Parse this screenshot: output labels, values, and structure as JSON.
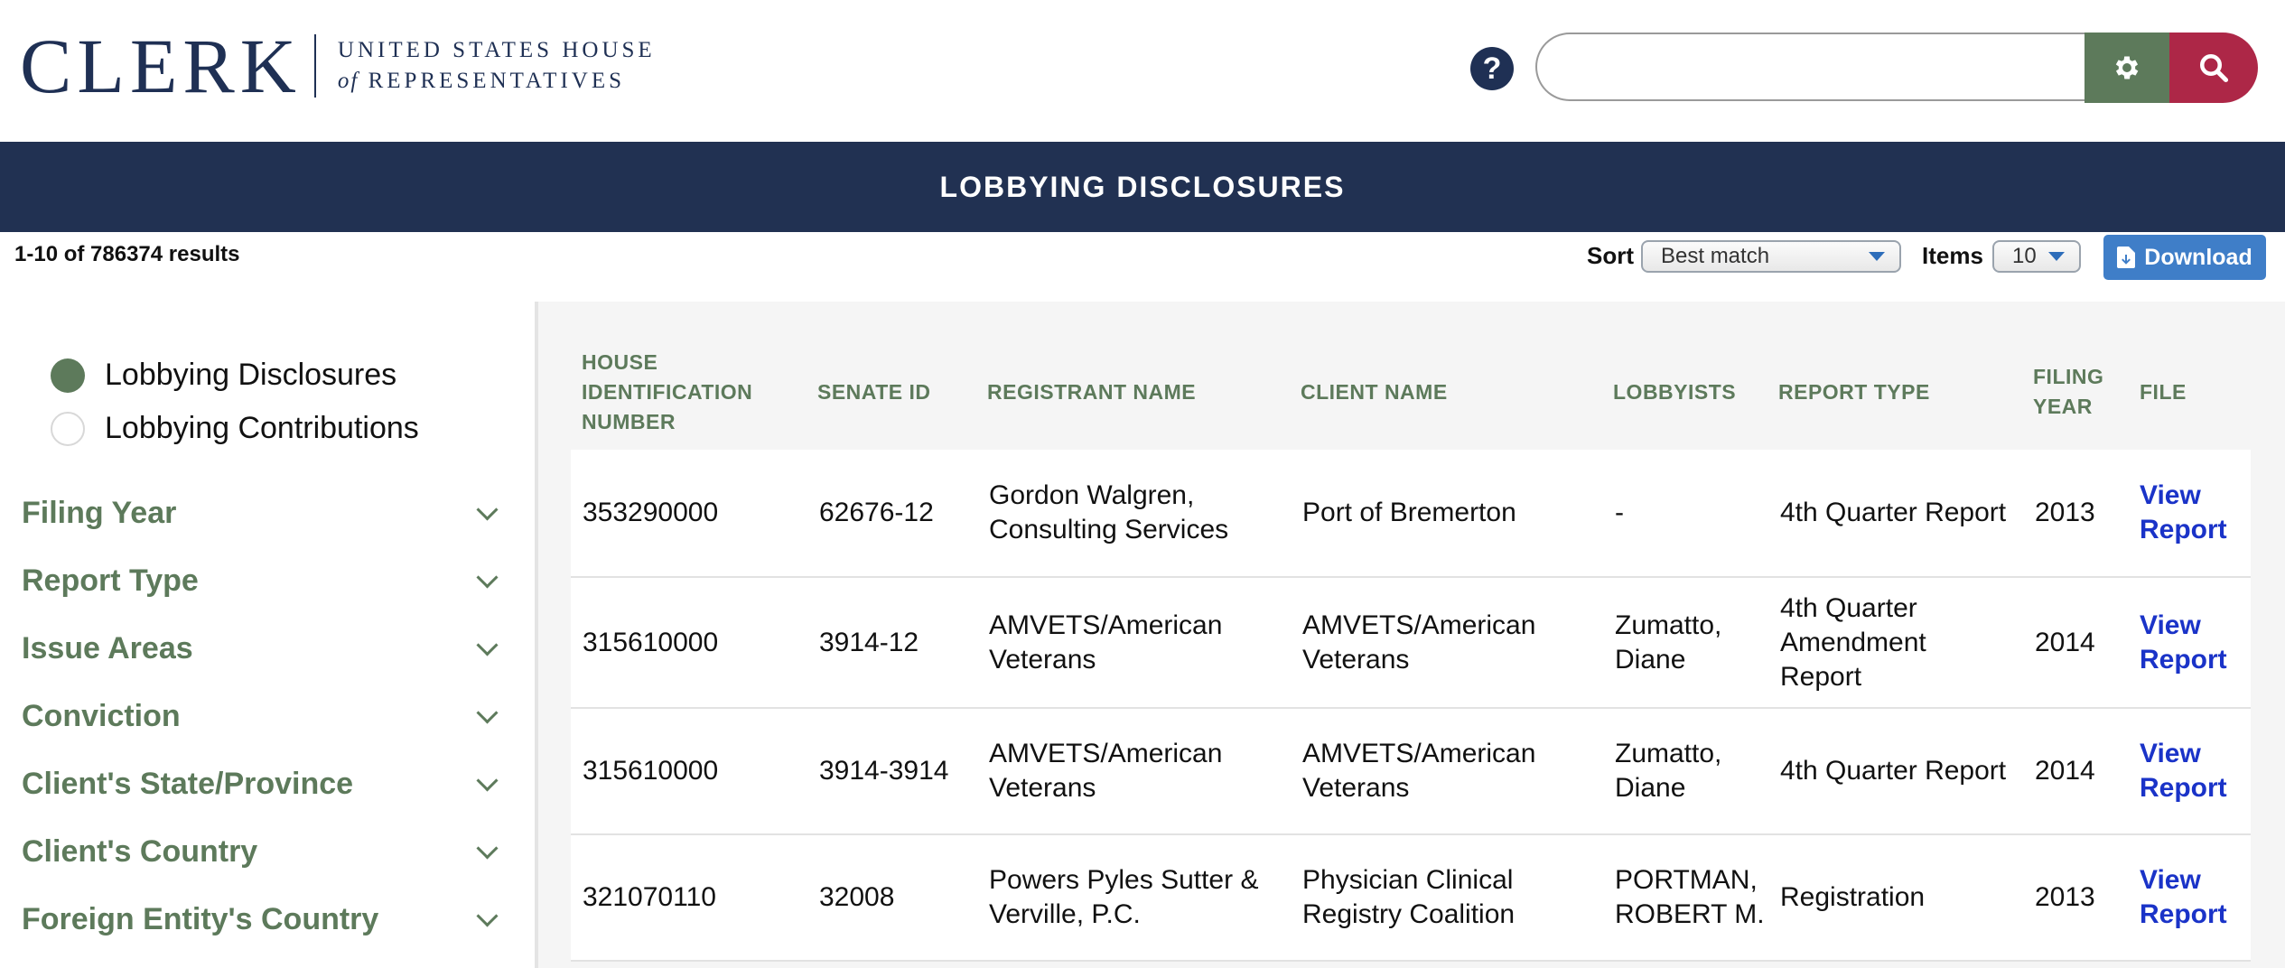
{
  "header": {
    "logo_word": "CLERK",
    "logo_line1": "UNITED STATES HOUSE",
    "logo_line2_of": "of",
    "logo_line2": "REPRESENTATIVES",
    "help_label": "?",
    "search_placeholder": ""
  },
  "banner": {
    "title": "LOBBYING DISCLOSURES"
  },
  "toolbar": {
    "results": "1-10 of 786374 results",
    "sort_label": "Sort",
    "sort_value": "Best match",
    "items_label": "Items",
    "items_value": "10",
    "download_label": "Download"
  },
  "sidebar": {
    "radios": [
      {
        "label": "Lobbying Disclosures",
        "selected": true
      },
      {
        "label": "Lobbying Contributions",
        "selected": false
      }
    ],
    "filters": [
      "Filing Year",
      "Report Type",
      "Issue Areas",
      "Conviction",
      "Client's State/Province",
      "Client's Country",
      "Foreign Entity's Country"
    ]
  },
  "table": {
    "headers": {
      "house_id": [
        "HOUSE",
        "IDENTIFICATION",
        "NUMBER"
      ],
      "senate_id": "SENATE ID",
      "registrant": "REGISTRANT NAME",
      "client": "CLIENT NAME",
      "lobbyists": "LOBBYISTS",
      "report_type": "REPORT TYPE",
      "filing_year": [
        "FILING",
        "YEAR"
      ],
      "file": "FILE"
    },
    "rows": [
      {
        "house_id": "353290000",
        "senate_id": "62676-12",
        "registrant": [
          "Gordon Walgren,",
          "Consulting Services"
        ],
        "client": [
          "Port of Bremerton"
        ],
        "lobbyists": [
          "-"
        ],
        "report_type": [
          "4th Quarter Report"
        ],
        "year": "2013",
        "file": [
          "View",
          "Report"
        ]
      },
      {
        "house_id": "315610000",
        "senate_id": "3914-12",
        "registrant": [
          "AMVETS/American",
          "Veterans"
        ],
        "client": [
          "AMVETS/American",
          "Veterans"
        ],
        "lobbyists": [
          "Zumatto,",
          "Diane"
        ],
        "report_type": [
          "4th Quarter",
          "Amendment",
          "Report"
        ],
        "year": "2014",
        "file": [
          "View",
          "Report"
        ]
      },
      {
        "house_id": "315610000",
        "senate_id": "3914-3914",
        "registrant": [
          "AMVETS/American",
          "Veterans"
        ],
        "client": [
          "AMVETS/American",
          "Veterans"
        ],
        "lobbyists": [
          "Zumatto,",
          "Diane"
        ],
        "report_type": [
          "4th Quarter Report"
        ],
        "year": "2014",
        "file": [
          "View",
          "Report"
        ]
      },
      {
        "house_id": "321070110",
        "senate_id": "32008",
        "registrant": [
          "Powers Pyles Sutter &",
          "Verville, P.C."
        ],
        "client": [
          "Physician Clinical",
          "Registry Coalition"
        ],
        "lobbyists": [
          "PORTMAN,",
          "ROBERT M."
        ],
        "report_type": [
          "Registration"
        ],
        "year": "2013",
        "file": [
          "View",
          "Report"
        ]
      }
    ]
  }
}
